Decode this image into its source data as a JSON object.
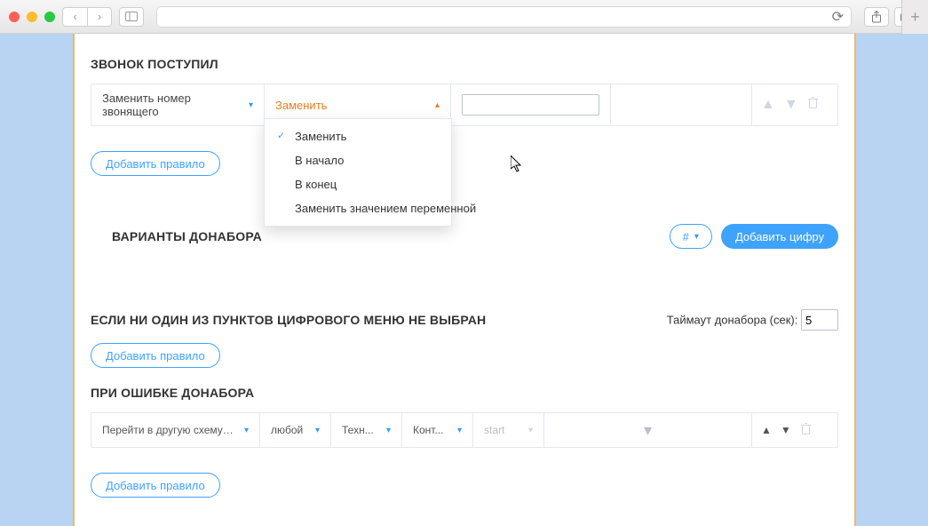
{
  "sections": {
    "incoming_title": "ЗВОНОК ПОСТУПИЛ",
    "variants_title": "ВАРИАНТЫ ДОНАБОРА",
    "no_select_title": "ЕСЛИ НИ ОДИН ИЗ ПУНКТОВ ЦИФРОВОГО МЕНЮ НЕ ВЫБРАН",
    "error_title": "ПРИ ОШИБКЕ ДОНАБОРА"
  },
  "rule1": {
    "action": "Заменить номер звонящего",
    "mode": "Заменить",
    "value": ""
  },
  "dropdown": {
    "items": [
      "Заменить",
      "В начало",
      "В конец",
      "Заменить значением переменной"
    ],
    "selected_index": 0
  },
  "buttons": {
    "add_rule": "Добавить правило",
    "add_digit": "Добавить цифру",
    "hash": "#"
  },
  "timeout": {
    "label": "Таймаут донабора (сек):",
    "value": "5"
  },
  "err_rule": {
    "action": "Перейти в другую схему обзвона если номер звонящего",
    "match": "любой",
    "c1": "Техн...",
    "c2": "Конт...",
    "c3": "start"
  }
}
